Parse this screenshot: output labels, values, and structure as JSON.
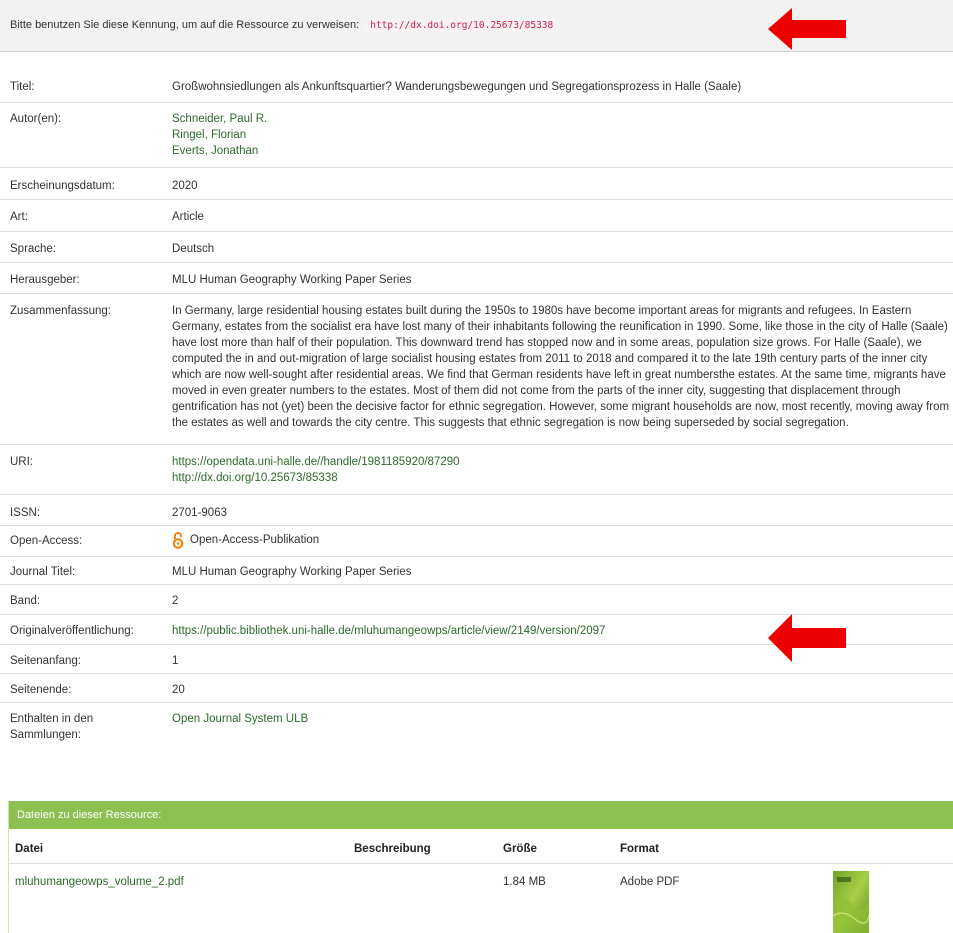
{
  "banner": {
    "text": "Bitte benutzen Sie diese Kennung, um auf die Ressource zu verweisen:",
    "identifier": "http://dx.doi.org/10.25673/85338"
  },
  "record": {
    "titel_label": "Titel:",
    "titel": "Großwohnsiedlungen als Ankunftsquartier? Wanderungsbewegungen und Segregationsprozess in Halle (Saale)",
    "autoren_label": "Autor(en):",
    "autoren": [
      "Schneider, Paul R.",
      "Ringel, Florian",
      "Everts, Jonathan"
    ],
    "datum_label": "Erscheinungsdatum:",
    "datum": "2020",
    "art_label": "Art:",
    "art": "Article",
    "sprache_label": "Sprache:",
    "sprache": "Deutsch",
    "herausgeber_label": "Herausgeber:",
    "herausgeber": "MLU Human Geography Working Paper Series",
    "zusammenfassung_label": "Zusammenfassung:",
    "zusammenfassung_lines": [
      "In Germany, large residential housing estates built during the 1950s to 1980s have become important areas for migrants and refugees. In Eastern",
      "Germany, estates from the socialist era have lost many of their inhabitants following the reunification in 1990. Some, like those in the city of Halle (Saale)",
      "have lost more than half of their population. This downward trend has stopped now and in some areas, population size grows. For Halle (Saale), we",
      "computed the in and out-migration of large socialist housing estates from 2011 to 2018 and compared it to the late 19th century parts of the inner city",
      "which are now well-sought after residential areas. We find that German residents have left in great numbersthe estates. At the same time, migrants have",
      "moved in even greater numbers to the estates. Most of them did not come from the parts of the inner city, suggesting that displacement through",
      "gentrification has not (yet) been the decisive factor for ethnic segregation. However, some migrant households are now, most recently, moving away from",
      "the estates as well and towards the city centre. This suggests that ethnic segregation is now being superseded by social segregation."
    ],
    "uri_label": "URI:",
    "uris": [
      "https://opendata.uni-halle.de//handle/1981185920/87290",
      "http://dx.doi.org/10.25673/85338"
    ],
    "issn_label": "ISSN:",
    "issn": "2701-9063",
    "oa_label": "Open-Access:",
    "oa": "Open-Access-Publikation",
    "journal_label": "Journal Titel:",
    "journal": "MLU Human Geography Working Paper Series",
    "band_label": "Band:",
    "band": "2",
    "original_label": "Originalveröffentlichung:",
    "original": "https://public.bibliothek.uni-halle.de/mluhumangeowps/article/view/2149/version/2097",
    "seitenanfang_label": "Seitenanfang:",
    "seitenanfang": "1",
    "seitenende_label": "Seitenende:",
    "seitenende": "20",
    "sammlungen_label_1": "Enthalten in den",
    "sammlungen_label_2": "Sammlungen:",
    "sammlungen": "Open Journal System ULB"
  },
  "files": {
    "heading": "Dateien zu dieser Ressource:",
    "columns": [
      "Datei",
      "Beschreibung",
      "Größe",
      "Format"
    ],
    "rows": [
      {
        "datei": "mluhumangeowps_volume_2.pdf",
        "beschreibung": "",
        "groesse": "1.84 MB",
        "format": "Adobe PDF"
      }
    ]
  },
  "colors": {
    "link": "#2b6b2b",
    "files_header": "#8cc152",
    "arrow": "#ee0000",
    "oa_icon": "#f68212"
  },
  "icons": [
    "red-arrow",
    "open-access-icon",
    "pdf-thumbnail"
  ]
}
